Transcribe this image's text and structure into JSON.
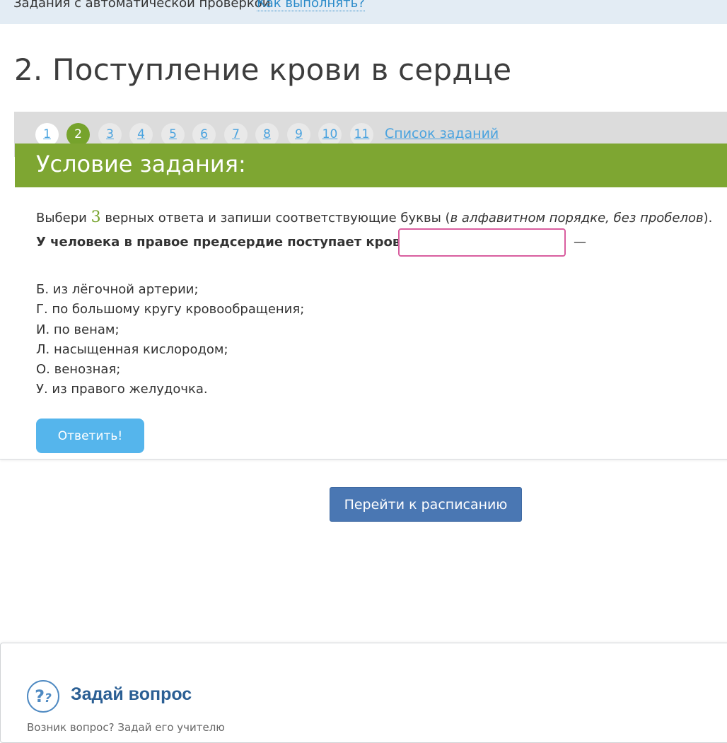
{
  "top_bar": {
    "label": "Задания с автоматической проверкой",
    "how_link": "Как выполнять?"
  },
  "page_title": "2. Поступление крови в сердце",
  "pager": {
    "pages": [
      "1",
      "2",
      "3",
      "4",
      "5",
      "6",
      "7",
      "8",
      "9",
      "10",
      "11"
    ],
    "active": "2",
    "list_link": "Список заданий"
  },
  "task": {
    "header": "Условие задания:",
    "instruction_pre": "Выбери ",
    "instruction_count": "3",
    "instruction_mid": " верных ответа и запиши соответствующие буквы (",
    "instruction_italic": "в алфавитном порядке, без пробелов",
    "instruction_post": ").",
    "question": "У человека в правое предсердие поступает кровь:",
    "answer_value": "",
    "dash": "—",
    "options": [
      "Б. из лёгочной артерии;",
      "Г. по большому кругу кровообращения;",
      "И. по венам;",
      "Л. насыщенная кислородом;",
      "О. венозная;",
      "У. из правого желудочка."
    ],
    "submit_label": "Ответить!"
  },
  "schedule_button": "Перейти к расписанию",
  "ask": {
    "icon": "question-icon",
    "title": "Задай вопрос",
    "subtitle": "Возник вопрос? Задай его учителю"
  },
  "colors": {
    "accent_green": "#7ea632",
    "link_blue": "#4aa3df",
    "button_blue": "#55b5ec",
    "schedule_blue": "#4a77b3",
    "input_border": "#d95e9f"
  }
}
